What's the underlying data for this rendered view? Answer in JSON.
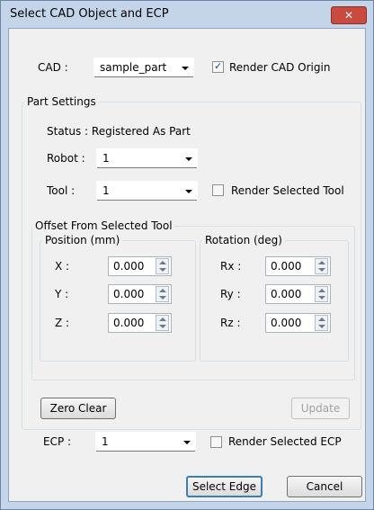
{
  "window": {
    "title": "Select CAD Object and ECP",
    "close_glyph": "✕"
  },
  "cad": {
    "label": "CAD :",
    "selected": "sample_part",
    "render_origin": {
      "label": "Render CAD Origin",
      "checked": true
    }
  },
  "part_settings": {
    "legend": "Part Settings",
    "status": "Status : Registered As Part",
    "robot": {
      "label": "Robot :",
      "selected": "1"
    },
    "tool": {
      "label": "Tool :",
      "selected": "1"
    },
    "render_tool": {
      "label": "Render Selected Tool",
      "checked": false
    }
  },
  "offset": {
    "legend": "Offset From Selected Tool",
    "position": {
      "legend": "Position (mm)",
      "x": {
        "label": "X :",
        "value": "0.000"
      },
      "y": {
        "label": "Y :",
        "value": "0.000"
      },
      "z": {
        "label": "Z :",
        "value": "0.000"
      }
    },
    "rotation": {
      "legend": "Rotation (deg)",
      "rx": {
        "label": "Rx :",
        "value": "0.000"
      },
      "ry": {
        "label": "Ry :",
        "value": "0.000"
      },
      "rz": {
        "label": "Rz :",
        "value": "0.000"
      }
    }
  },
  "buttons": {
    "zero_clear": "Zero Clear",
    "update": "Update",
    "select_edge": "Select Edge",
    "cancel": "Cancel"
  },
  "ecp": {
    "label": "ECP :",
    "selected": "1",
    "render": {
      "label": "Render Selected ECP",
      "checked": false
    }
  },
  "colors": {
    "title_bar": "#c4d5e9",
    "close_button": "#c94a3e",
    "dialog_bg": "#f0f0f0"
  }
}
